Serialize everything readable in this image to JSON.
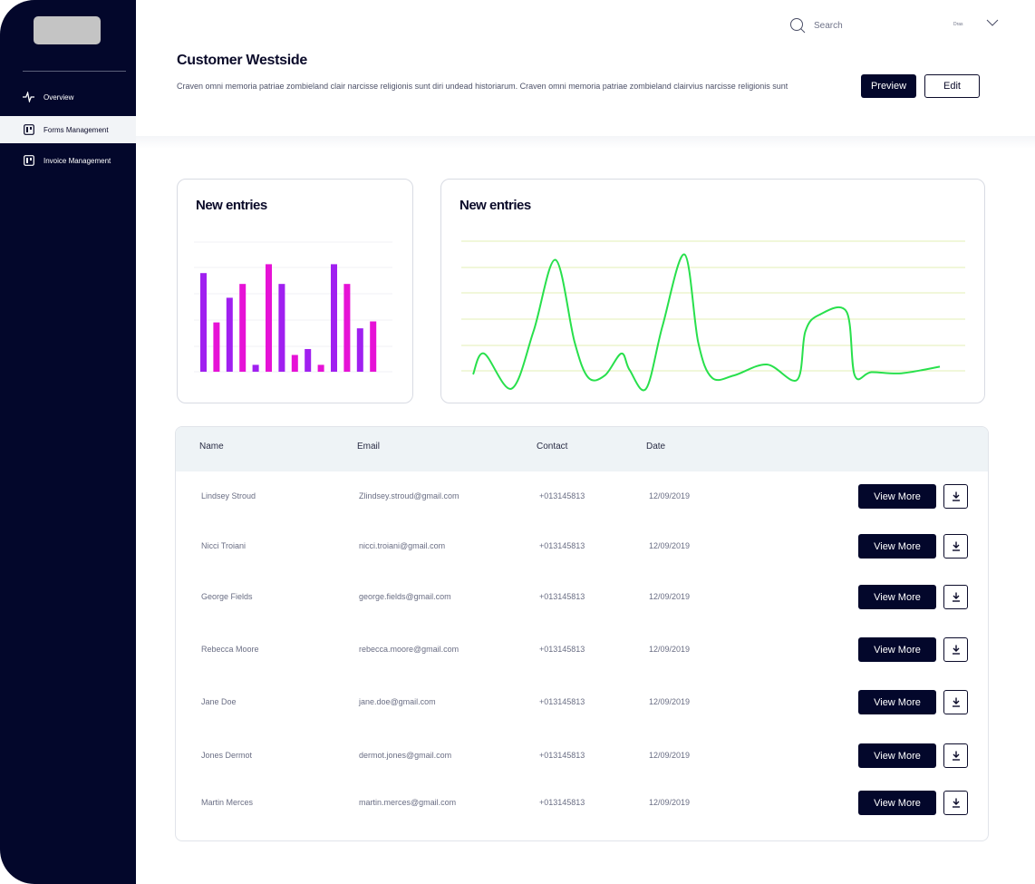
{
  "sidebar": {
    "items": [
      {
        "label": "Overview",
        "icon": "activity-icon"
      },
      {
        "label": "Forms Management",
        "icon": "board-icon",
        "active": true
      },
      {
        "label": "Invoice Management",
        "icon": "board-icon"
      }
    ]
  },
  "topbar": {
    "search_placeholder": "Search",
    "user_name": "Dras"
  },
  "header": {
    "title": "Customer Westside",
    "description": "Craven omni memoria patriae zombieland clair narcisse religionis sunt diri undead historiarum. Craven omni memoria patriae zombieland clairvius narcisse religionis sunt",
    "preview_label": "Preview",
    "edit_label": "Edit"
  },
  "colors": {
    "navy": "#03072b",
    "bar_purple": "#a020f0",
    "bar_magenta": "#e612d6",
    "line_green": "#28e04c",
    "grid_green": "#e3efb4"
  },
  "chart_data": [
    {
      "type": "bar",
      "title": "New entries",
      "values": [
        100,
        50,
        75,
        89,
        7,
        109,
        89,
        17,
        23,
        7,
        109,
        89,
        44,
        51
      ],
      "colors": [
        "#a020f0",
        "#e612d6",
        "#a020f0",
        "#e612d6",
        "#a020f0",
        "#e612d6",
        "#a020f0",
        "#e612d6",
        "#a020f0",
        "#e612d6",
        "#a020f0",
        "#e612d6",
        "#a020f0",
        "#e612d6"
      ],
      "ylim": [
        0,
        125
      ]
    },
    {
      "type": "line",
      "title": "New entries",
      "x": [
        0,
        4,
        14,
        22,
        30,
        37,
        42,
        48,
        54,
        57,
        63,
        69,
        77,
        82,
        87,
        95,
        107,
        118,
        121,
        126,
        136,
        139,
        145,
        156,
        170
      ],
      "y": [
        1,
        20,
        -12,
        40,
        105,
        30,
        -2,
        0,
        20,
        5,
        -12,
        45,
        110,
        30,
        -2,
        0,
        10,
        -4,
        40,
        55,
        58,
        0,
        3,
        2,
        8
      ],
      "ylim": [
        -18,
        122
      ]
    }
  ],
  "table": {
    "headers": [
      "Name",
      "Email",
      "Contact",
      "Date"
    ],
    "view_label": "View More",
    "rows": [
      {
        "name": "Lindsey Stroud",
        "email": "Zlindsey.stroud@gmail.com",
        "contact": "+013145813",
        "date": "12/09/2019"
      },
      {
        "name": "Nicci Troiani",
        "email": "nicci.troiani@gmail.com",
        "contact": "+013145813",
        "date": "12/09/2019"
      },
      {
        "name": "George Fields",
        "email": "george.fields@gmail.com",
        "contact": "+013145813",
        "date": "12/09/2019"
      },
      {
        "name": "Rebecca Moore",
        "email": "rebecca.moore@gmail.com",
        "contact": "+013145813",
        "date": "12/09/2019"
      },
      {
        "name": "Jane Doe",
        "email": "jane.doe@gmail.com",
        "contact": "+013145813",
        "date": "12/09/2019"
      },
      {
        "name": "Jones Dermot",
        "email": "dermot.jones@gmail.com",
        "contact": "+013145813",
        "date": "12/09/2019"
      },
      {
        "name": "Martin Merces",
        "email": "martin.merces@gmail.com",
        "contact": "+013145813",
        "date": "12/09/2019"
      }
    ]
  }
}
